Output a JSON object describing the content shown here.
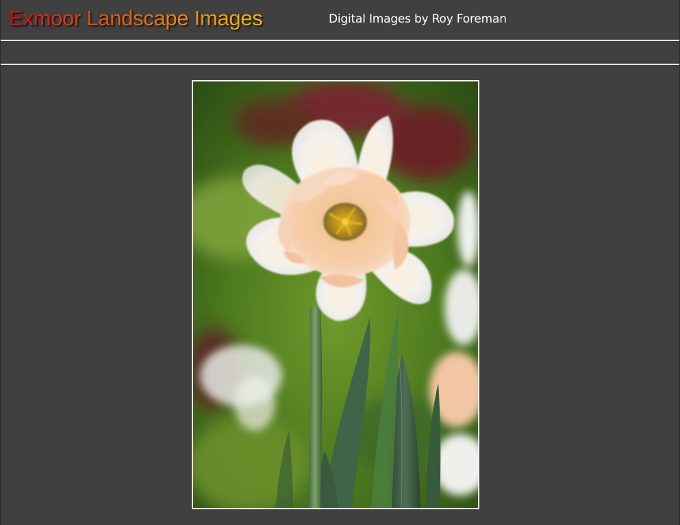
{
  "header": {
    "title": "Exmoor Landscape Images",
    "subtitle": "Digital Images by Roy Foreman"
  },
  "colors": {
    "background": "#404040",
    "divider": "#e6e6e6",
    "title_gradient_start": "#c4120f",
    "title_gradient_end": "#f3b71b",
    "subtitle_text": "#ffffff",
    "photo_border": "#f4f4f4"
  }
}
